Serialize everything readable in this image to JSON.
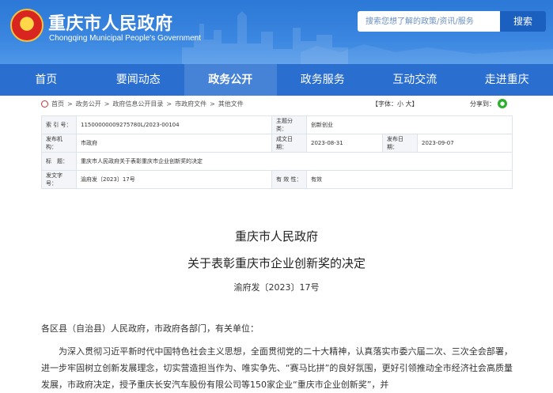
{
  "header": {
    "site_title": "重庆市人民政府",
    "site_subtitle": "Chongqing Municipal People's Government",
    "search_placeholder": "搜索您想了解的政策/资讯/服务",
    "search_button": "搜索"
  },
  "nav": [
    {
      "label": "首页"
    },
    {
      "label": "要闻动态"
    },
    {
      "label": "政务公开"
    },
    {
      "label": "政务服务"
    },
    {
      "label": "互动交流"
    },
    {
      "label": "走进重庆"
    }
  ],
  "breadcrumb": [
    "首页",
    "政务公开",
    "政府信息公开目录",
    "市政府文件",
    "其他文件"
  ],
  "font_control": "【字体：小 大】",
  "share_label": "分享到：",
  "info": {
    "index_label": "索 引 号：",
    "index_value": "11500000009275780L/2023-00104",
    "topic_label": "主题分类：",
    "topic_value": "创新创业",
    "issuer_label": "发布机构：",
    "issuer_value": "市政府",
    "written_label": "成文日期：",
    "written_value": "2023-08-31",
    "publish_label": "发布日期：",
    "publish_value": "2023-09-07",
    "title_label": "标　题：",
    "title_value": "重庆市人民政府关于表彰重庆市企业创新奖的决定",
    "docno_label": "发文字号：",
    "docno_value": "渝府发〔2023〕17号",
    "valid_label": "有 效 性：",
    "valid_value": "有效"
  },
  "doc": {
    "org": "重庆市人民政府",
    "title": "关于表彰重庆市企业创新奖的决定",
    "number": "渝府发〔2023〕17号",
    "address": "各区县（自治县）人民政府，市政府各部门，有关单位：",
    "paragraph": "为深入贯彻习近平新时代中国特色社会主义思想，全面贯彻党的二十大精神，认真落实市委六届二次、三次全会部署，进一步牢固树立创新发展理念，切实营造担当作为、唯实争先、“赛马比拼”的良好氛围，更好引领推动全市经济社会高质量发展，市政府决定，授予重庆长安汽车股份有限公司等150家企业“重庆市企业创新奖”，并"
  }
}
